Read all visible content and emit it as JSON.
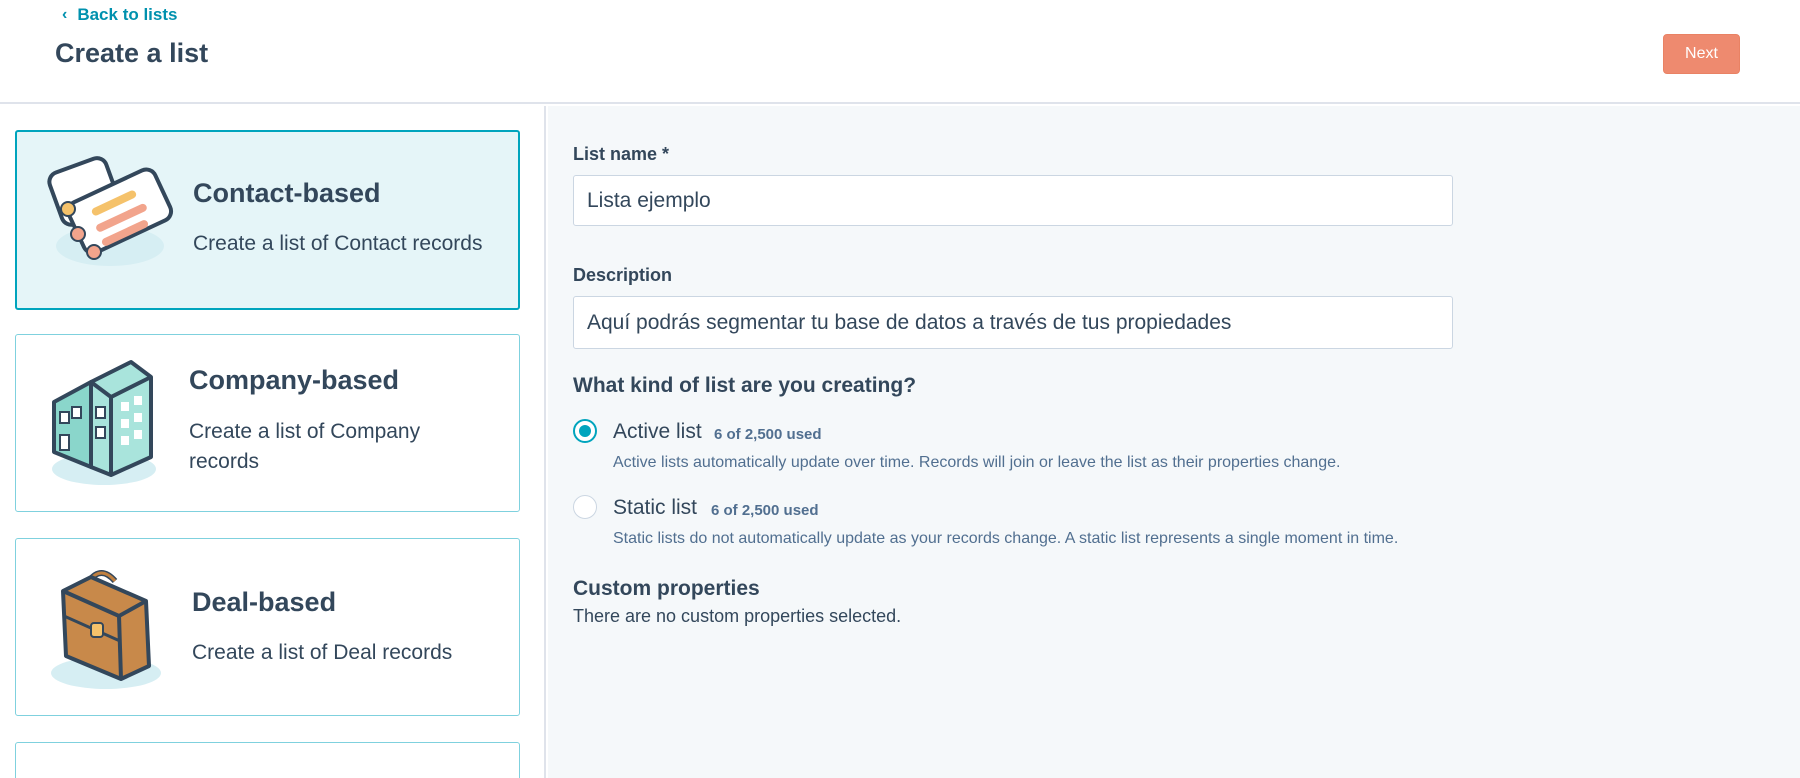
{
  "header": {
    "back_label": "Back to lists",
    "title": "Create a list",
    "next_label": "Next"
  },
  "cards": [
    {
      "title": "Contact-based",
      "desc": "Create a list of Contact records",
      "icon": "contact-records-illustration",
      "selected": true
    },
    {
      "title": "Company-based",
      "desc": "Create a list of Company records",
      "icon": "company-building-illustration",
      "selected": false
    },
    {
      "title": "Deal-based",
      "desc": "Create a list of Deal records",
      "icon": "briefcase-illustration",
      "selected": false
    }
  ],
  "form": {
    "list_name_label": "List name *",
    "list_name_value": "Lista ejemplo",
    "description_label": "Description",
    "description_value": "Aquí podrás segmentar tu base de datos a través de tus propiedades",
    "kind_title": "What kind of list are you creating?",
    "options": [
      {
        "label": "Active list",
        "usage": "6 of 2,500 used",
        "help": "Active lists automatically update over time. Records will join or leave the list as their properties change.",
        "checked": true
      },
      {
        "label": "Static list",
        "usage": "6 of 2,500 used",
        "help": "Static lists do not automatically update as your records change. A static list represents a single moment in time.",
        "checked": false
      }
    ],
    "custom_title": "Custom properties",
    "custom_text": "There are no custom properties selected."
  },
  "colors": {
    "accent": "#00a4bd",
    "primary_button": "#ee8a6f",
    "text": "#33475b",
    "link": "#0091ae"
  }
}
